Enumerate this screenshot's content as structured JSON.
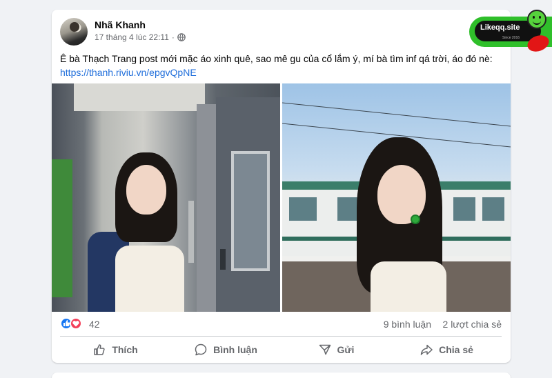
{
  "post": {
    "author": "Nhã Khanh",
    "timestamp": "17 tháng 4 lúc 22:11",
    "audience_icon": "globe-icon",
    "text": "Ê bà Thạch Trang post mới mặc áo xinh quê, sao mê gu của cổ lắm ý, mí bà tìm inf qá trời, áo đó nè:",
    "link": "https://thanh.riviu.vn/epgvQpNE"
  },
  "watermark": {
    "brand": "Likeqq.site",
    "sub": "Since 2016"
  },
  "stats": {
    "reaction_icons": [
      "like-icon",
      "love-icon"
    ],
    "reactions": "42",
    "comments": "9 bình luận",
    "shares": "2 lượt chia sẻ"
  },
  "actions": {
    "like": "Thích",
    "comment": "Bình luận",
    "send": "Gửi",
    "share": "Chia sẻ"
  },
  "colors": {
    "link": "#216fdb",
    "muted_text": "#65676b",
    "like_blue": "#1877f2",
    "love_red": "#f33e58",
    "background": "#f0f2f5"
  }
}
